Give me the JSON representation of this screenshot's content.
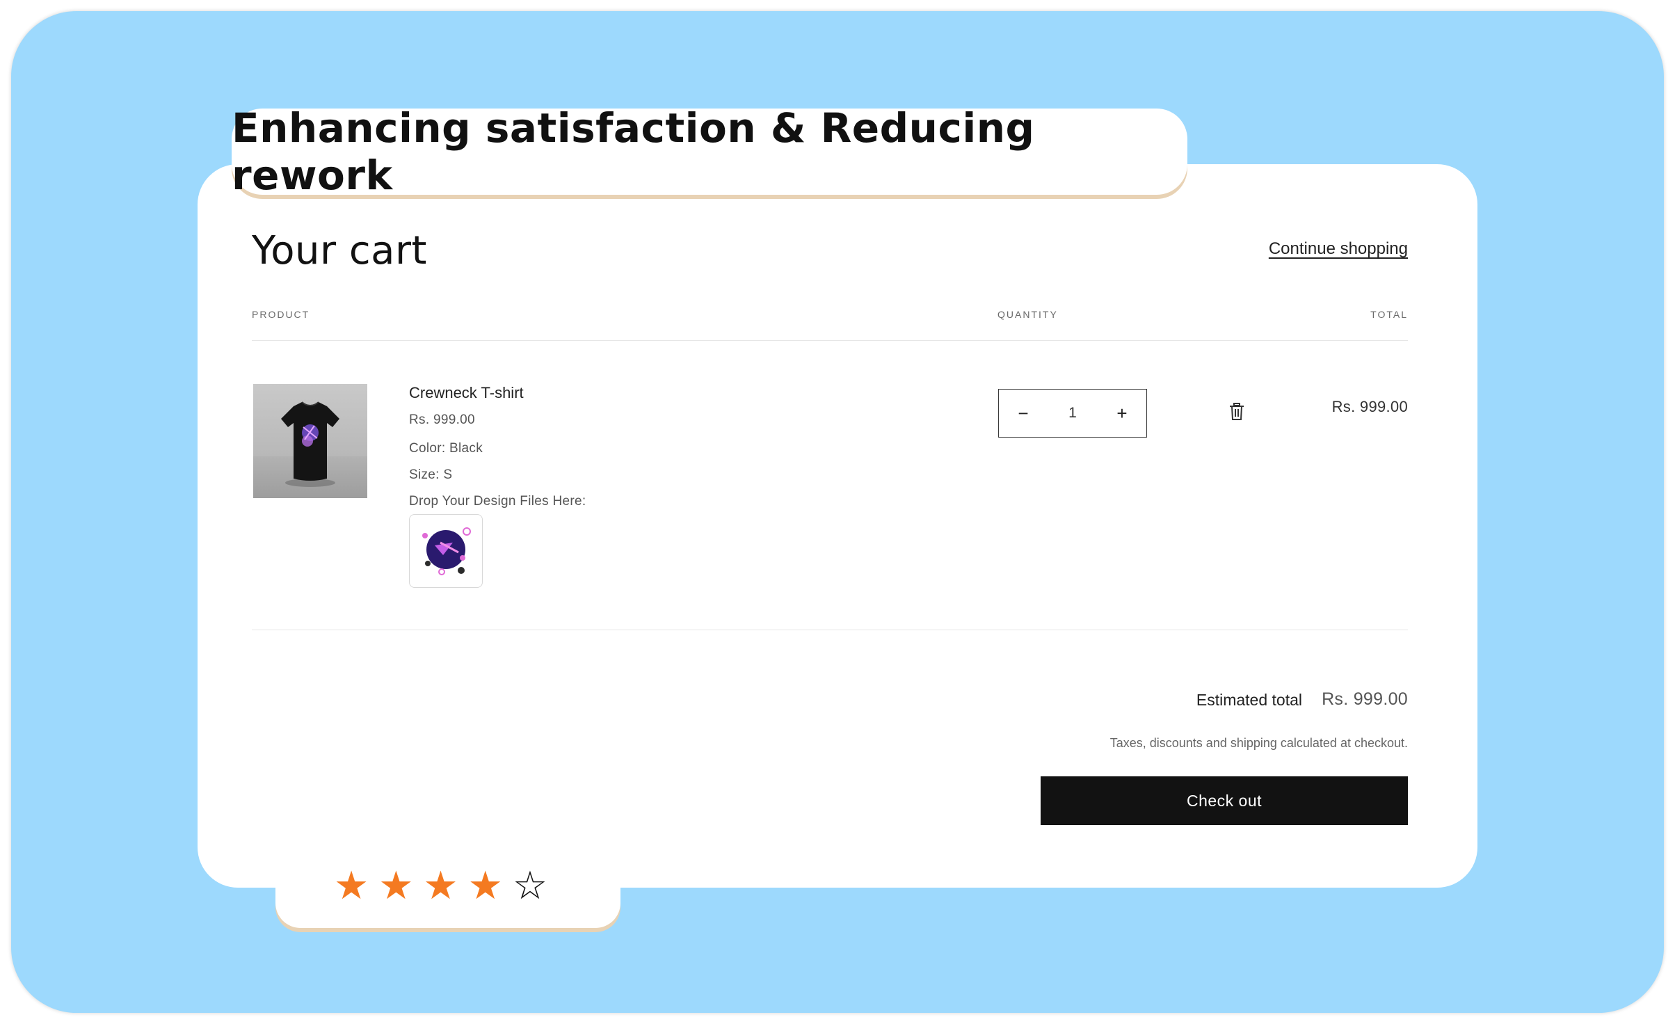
{
  "banner": {
    "headline": "Enhancing satisfaction & Reducing rework"
  },
  "cart": {
    "title": "Your cart",
    "continue_link": "Continue shopping",
    "columns": {
      "product": "PRODUCT",
      "quantity": "QUANTITY",
      "total": "TOTAL"
    },
    "items": [
      {
        "name": "Crewneck T-shirt",
        "price": "Rs. 999.00",
        "color": "Color: Black",
        "size": "Size: S",
        "design_prompt": "Drop Your Design Files Here:",
        "quantity": "1",
        "line_total": "Rs. 999.00",
        "decrease_symbol": "−",
        "increase_symbol": "+",
        "product_image_icon": "tshirt-image",
        "design_image_icon": "uploaded-design-image",
        "remove_icon": "trash-icon"
      }
    ],
    "summary": {
      "estimated_label": "Estimated total",
      "estimated_value": "Rs. 999.00",
      "tax_note": "Taxes, discounts and shipping calculated at checkout.",
      "checkout_label": "Check out"
    }
  },
  "rating": {
    "value": 4,
    "max": 5,
    "filled_glyph": "★",
    "empty_glyph": "☆",
    "color": "#f47a21"
  },
  "colors": {
    "background": "#9dd9fd",
    "accent_shadow": "#e8d2b4",
    "button": "#121212"
  }
}
